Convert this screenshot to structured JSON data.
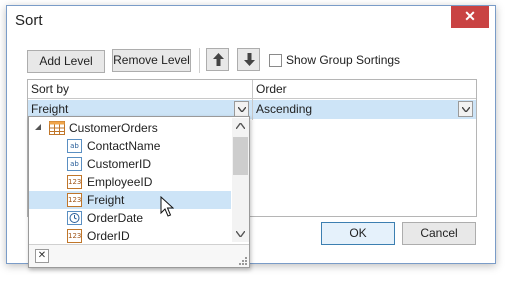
{
  "window": {
    "title": "Sort",
    "close_glyph": "✕"
  },
  "toolbar": {
    "add_level_label": "Add Level",
    "remove_level_label": "Remove Level",
    "move_up_icon": "arrow-up-icon",
    "move_down_icon": "arrow-down-icon",
    "show_group_sortings_label": "Show Group Sortings",
    "show_group_sortings_checked": false
  },
  "grid": {
    "columns": [
      "Sort by",
      "Order"
    ],
    "row": {
      "sort_by": "Freight",
      "order": "Ascending"
    }
  },
  "field_list": {
    "root": {
      "label": "CustomerOrders",
      "icon": "table-icon"
    },
    "items": [
      {
        "label": "ContactName",
        "icon": "ab",
        "selected": false
      },
      {
        "label": "CustomerID",
        "icon": "ab",
        "selected": false
      },
      {
        "label": "EmployeeID",
        "icon": "123",
        "selected": false
      },
      {
        "label": "Freight",
        "icon": "123",
        "selected": true
      },
      {
        "label": "OrderDate",
        "icon": "clock-icon",
        "selected": false
      },
      {
        "label": "OrderID",
        "icon": "123",
        "selected": false
      }
    ],
    "clear_glyph": "✕"
  },
  "footer": {
    "ok_label": "OK",
    "cancel_label": "Cancel"
  }
}
